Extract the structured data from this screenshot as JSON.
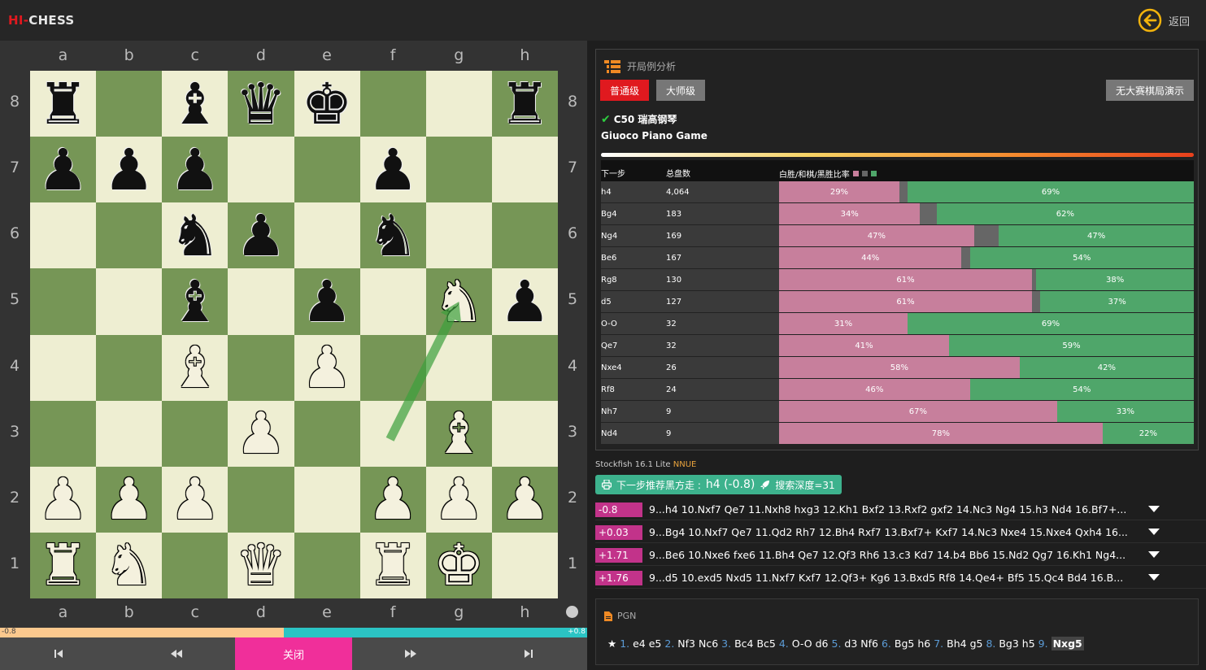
{
  "header": {
    "logo_hi": "HI-",
    "logo_chess": "CHESS",
    "back_label": "返回"
  },
  "board": {
    "files": [
      "a",
      "b",
      "c",
      "d",
      "e",
      "f",
      "g",
      "h"
    ],
    "ranks": [
      "8",
      "7",
      "6",
      "5",
      "4",
      "3",
      "2",
      "1"
    ],
    "pieces": [
      {
        "sq": "a8",
        "p": "rook",
        "c": "b"
      },
      {
        "sq": "c8",
        "p": "bishop",
        "c": "b"
      },
      {
        "sq": "d8",
        "p": "queen",
        "c": "b"
      },
      {
        "sq": "e8",
        "p": "king",
        "c": "b"
      },
      {
        "sq": "h8",
        "p": "rook",
        "c": "b"
      },
      {
        "sq": "a7",
        "p": "pawn",
        "c": "b"
      },
      {
        "sq": "b7",
        "p": "pawn",
        "c": "b"
      },
      {
        "sq": "c7",
        "p": "pawn",
        "c": "b"
      },
      {
        "sq": "f7",
        "p": "pawn",
        "c": "b"
      },
      {
        "sq": "c6",
        "p": "knight",
        "c": "b"
      },
      {
        "sq": "d6",
        "p": "pawn",
        "c": "b"
      },
      {
        "sq": "f6",
        "p": "knight",
        "c": "b"
      },
      {
        "sq": "c5",
        "p": "bishop",
        "c": "b"
      },
      {
        "sq": "e5",
        "p": "pawn",
        "c": "b"
      },
      {
        "sq": "g5",
        "p": "knight",
        "c": "w"
      },
      {
        "sq": "h5",
        "p": "pawn",
        "c": "b"
      },
      {
        "sq": "c4",
        "p": "bishop",
        "c": "w"
      },
      {
        "sq": "e4",
        "p": "pawn",
        "c": "w"
      },
      {
        "sq": "d3",
        "p": "pawn",
        "c": "w"
      },
      {
        "sq": "g3",
        "p": "bishop",
        "c": "w"
      },
      {
        "sq": "a2",
        "p": "pawn",
        "c": "w"
      },
      {
        "sq": "b2",
        "p": "pawn",
        "c": "w"
      },
      {
        "sq": "c2",
        "p": "pawn",
        "c": "w"
      },
      {
        "sq": "f2",
        "p": "pawn",
        "c": "w"
      },
      {
        "sq": "g2",
        "p": "pawn",
        "c": "w"
      },
      {
        "sq": "h2",
        "p": "pawn",
        "c": "w"
      },
      {
        "sq": "a1",
        "p": "rook",
        "c": "w"
      },
      {
        "sq": "b1",
        "p": "knight",
        "c": "w"
      },
      {
        "sq": "d1",
        "p": "queen",
        "c": "w"
      },
      {
        "sq": "f1",
        "p": "rook",
        "c": "w"
      },
      {
        "sq": "g1",
        "p": "king",
        "c": "w"
      }
    ],
    "last_move_arrow": {
      "from": "f3",
      "to": "g5"
    }
  },
  "eval_bar": {
    "min": "-0.8",
    "max": "+0.8",
    "white_fraction": 0.483
  },
  "controls": {
    "close_label": "关闭"
  },
  "opening": {
    "title": "开局例分析",
    "btn_normal": "普通级",
    "btn_master": "大师级",
    "btn_demo": "无大赛棋局演示",
    "code": "C50 瑞高钢琴",
    "name": "Giuoco Piano Game",
    "col_next": "下一步",
    "col_total": "总盘数",
    "col_ratio": "白胜/和棋/黑胜比率",
    "colors": {
      "white": "#c77f9c",
      "draw": "#666666",
      "black": "#4fa66a"
    },
    "rows": [
      {
        "move": "h4",
        "games": "4,064",
        "w": 29,
        "d": 2,
        "b": 69,
        "wl": "29%",
        "bl": "69%"
      },
      {
        "move": "Bg4",
        "games": "183",
        "w": 34,
        "d": 4,
        "b": 62,
        "wl": "34%",
        "bl": "62%"
      },
      {
        "move": "Ng4",
        "games": "169",
        "w": 47,
        "d": 6,
        "b": 47,
        "wl": "47%",
        "bl": "47%"
      },
      {
        "move": "Be6",
        "games": "167",
        "w": 44,
        "d": 2,
        "b": 54,
        "wl": "44%",
        "bl": "54%"
      },
      {
        "move": "Rg8",
        "games": "130",
        "w": 61,
        "d": 1,
        "b": 38,
        "wl": "61%",
        "bl": "38%"
      },
      {
        "move": "d5",
        "games": "127",
        "w": 61,
        "d": 2,
        "b": 37,
        "wl": "61%",
        "bl": "37%"
      },
      {
        "move": "O-O",
        "games": "32",
        "w": 31,
        "d": 0,
        "b": 69,
        "wl": "31%",
        "bl": "69%"
      },
      {
        "move": "Qe7",
        "games": "32",
        "w": 41,
        "d": 0,
        "b": 59,
        "wl": "41%",
        "bl": "59%"
      },
      {
        "move": "Nxe4",
        "games": "26",
        "w": 58,
        "d": 0,
        "b": 42,
        "wl": "58%",
        "bl": "42%"
      },
      {
        "move": "Rf8",
        "games": "24",
        "w": 46,
        "d": 0,
        "b": 54,
        "wl": "46%",
        "bl": "54%"
      },
      {
        "move": "Nh7",
        "games": "9",
        "w": 67,
        "d": 0,
        "b": 33,
        "wl": "67%",
        "bl": "33%"
      },
      {
        "move": "Nd4",
        "games": "9",
        "w": 78,
        "d": 0,
        "b": 22,
        "wl": "78%",
        "bl": "22%"
      }
    ]
  },
  "engine": {
    "name": "Stockfish 16.1 Lite",
    "nnue": "NNUE",
    "rec_prefix": "下一步推荐黑方走 : ",
    "rec_move": "h4 (-0.8)",
    "depth": "搜索深度=31",
    "lines": [
      {
        "score": "-0.8",
        "pv": "9...h4 10.Nxf7 Qe7 11.Nxh8 hxg3 12.Kh1 Bxf2 13.Rxf2 gxf2 14.Nc3 Ng4 15.h3 Nd4 16.Bf7+..."
      },
      {
        "score": "+0.03",
        "pv": "9...Bg4 10.Nxf7 Qe7 11.Qd2 Rh7 12.Bh4 Rxf7 13.Bxf7+ Kxf7 14.Nc3 Nxe4 15.Nxe4 Qxh4 16..."
      },
      {
        "score": "+1.71",
        "pv": "9...Be6 10.Nxe6 fxe6 11.Bh4 Qe7 12.Qf3 Rh6 13.c3 Kd7 14.b4 Bb6 15.Nd2 Qg7 16.Kh1 Ng4..."
      },
      {
        "score": "+1.76",
        "pv": "9...d5 10.exd5 Nxd5 11.Nxf7 Kxf7 12.Qf3+ Kg6 13.Bxd5 Rf8 14.Qe4+ Bf5 15.Qc4 Bd4 16.B..."
      }
    ]
  },
  "pgn": {
    "title": "PGN",
    "moves": [
      {
        "n": "1.",
        "w": "e4",
        "b": "e5"
      },
      {
        "n": "2.",
        "w": "Nf3",
        "b": "Nc6"
      },
      {
        "n": "3.",
        "w": "Bc4",
        "b": "Bc5"
      },
      {
        "n": "4.",
        "w": "O-O",
        "b": "d6"
      },
      {
        "n": "5.",
        "w": "d3",
        "b": "Nf6"
      },
      {
        "n": "6.",
        "w": "Bg5",
        "b": "h6"
      },
      {
        "n": "7.",
        "w": "Bh4",
        "b": "g5"
      },
      {
        "n": "8.",
        "w": "Bg3",
        "b": "h5"
      },
      {
        "n": "9.",
        "w": "Nxg5",
        "b": ""
      }
    ]
  }
}
